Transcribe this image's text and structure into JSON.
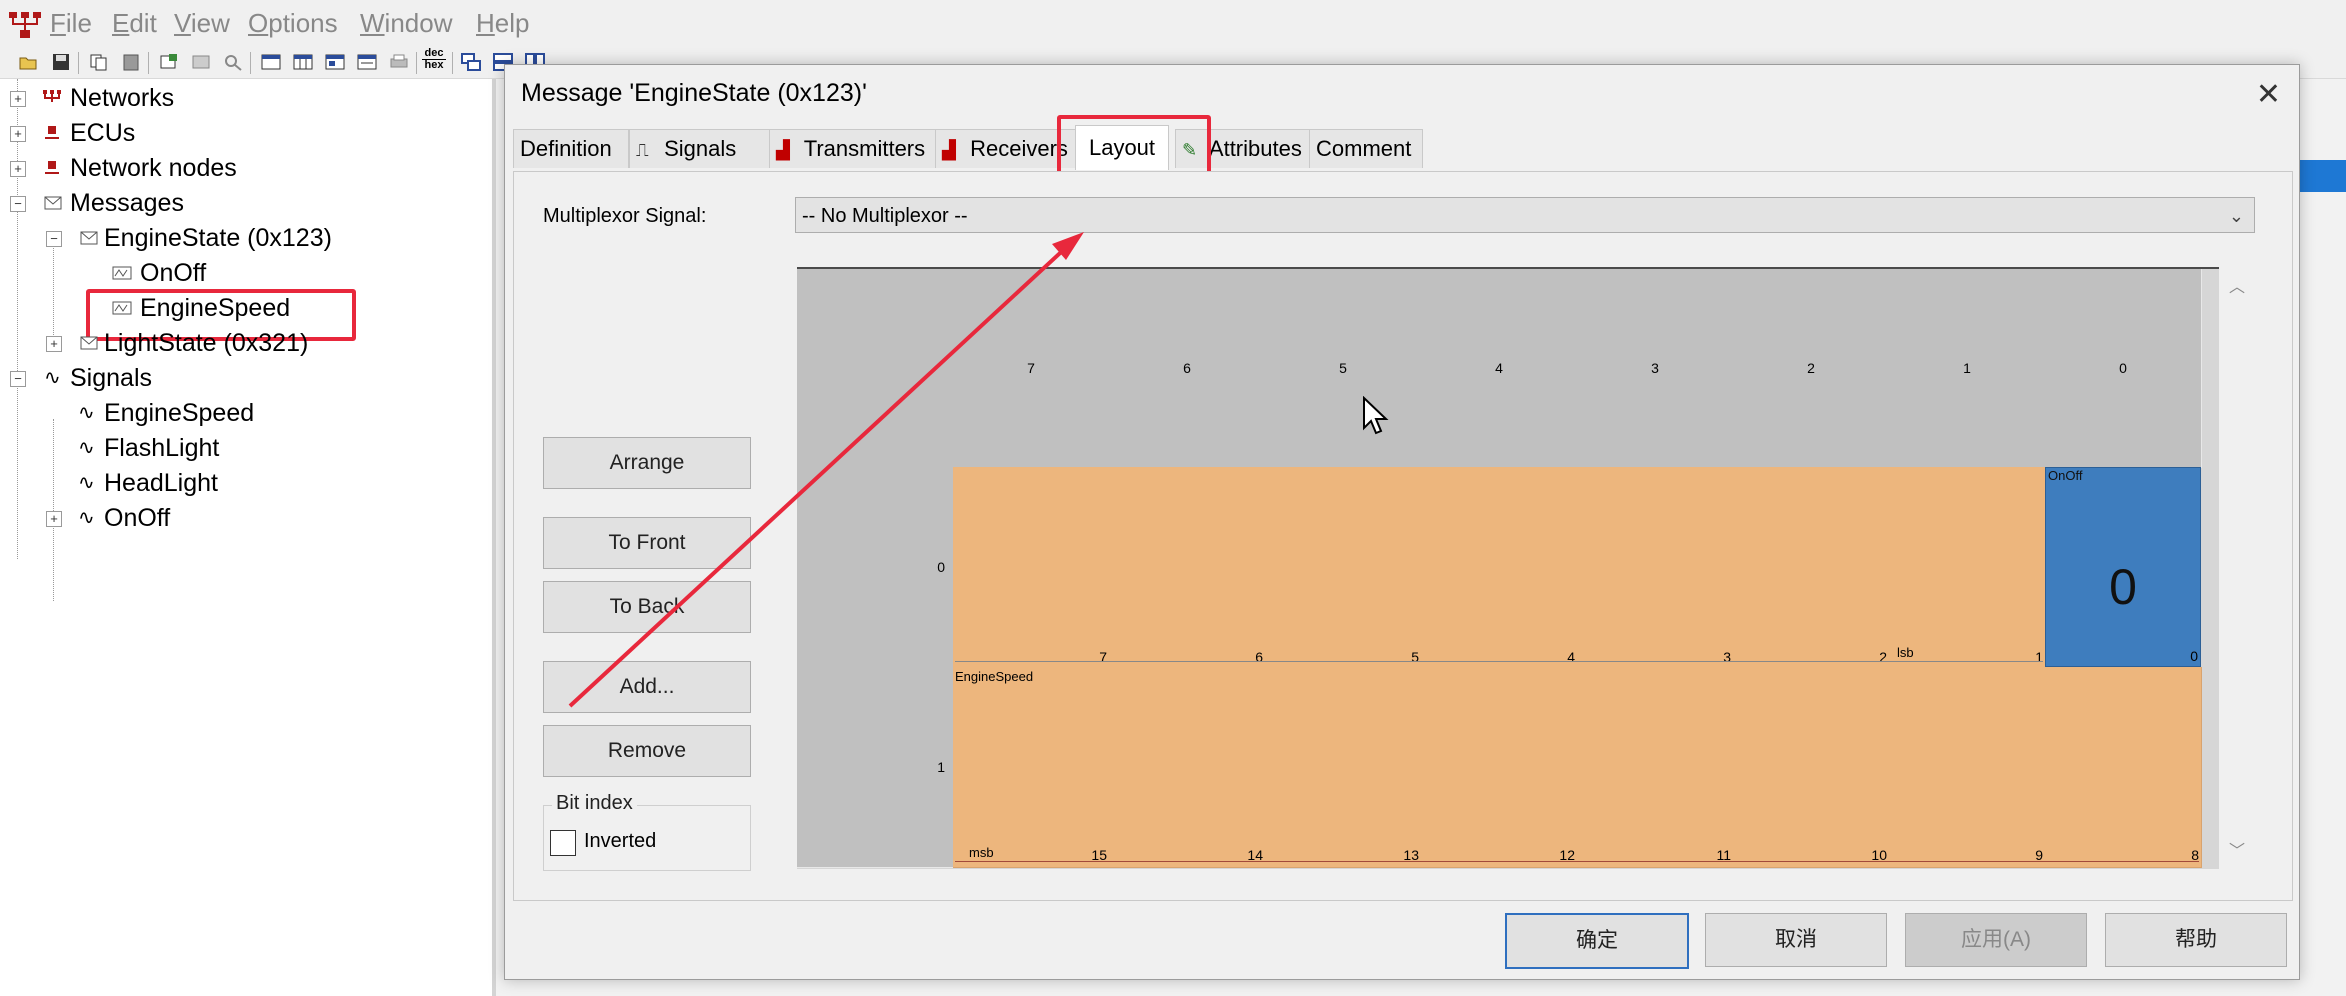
{
  "menubar": {
    "items": [
      "File",
      "Edit",
      "View",
      "Options",
      "Window",
      "Help"
    ],
    "underlines": [
      "F",
      "E",
      "V",
      "O",
      "W",
      "H"
    ],
    "rests": [
      "ile",
      "dit",
      "iew",
      "ptions",
      "indow",
      "elp"
    ]
  },
  "toolbar": {
    "icons": [
      "open-icon",
      "save-icon",
      "copy-icon",
      "paste-icon",
      "properties-icon",
      "grid-icon",
      "find-icon",
      "table-icon",
      "columns-icon",
      "window-icon",
      "window-alt-icon",
      "print-icon",
      "dec-hex-icon",
      "cascade-icon",
      "tile-horizontal-icon",
      "tile-vertical-icon"
    ],
    "dec_hex_label_top": "dec",
    "dec_hex_label_bottom": "hex"
  },
  "tree": {
    "networks": "Networks",
    "ecus": "ECUs",
    "network_nodes": "Network nodes",
    "messages": "Messages",
    "engine_state": "EngineState (0x123)",
    "onoff_child": "OnOff",
    "enginespeed_child": "EngineSpeed",
    "light_state": "LightState (0x321)",
    "signals": "Signals",
    "sig_enginespeed": "EngineSpeed",
    "sig_flashlight": "FlashLight",
    "sig_headlight": "HeadLight",
    "sig_onoff": "OnOff"
  },
  "dialog": {
    "title": "Message 'EngineState (0x123)'",
    "close": "✕",
    "tabs": {
      "definition": "Definition",
      "signals": "Signals",
      "transmitters": "Transmitters",
      "receivers": "Receivers",
      "layout": "Layout",
      "attributes": "Attributes",
      "comment": "Comment"
    },
    "multiplexor_label": "Multiplexor Signal:",
    "multiplexor_value": "-- No Multiplexor --",
    "buttons": {
      "arrange": "Arrange",
      "to_front": "To Front",
      "to_back": "To Back",
      "add": "Add...",
      "remove": "Remove"
    },
    "bit_index": {
      "title": "Bit index",
      "inverted": "Inverted",
      "checked": false
    },
    "footer": {
      "ok": "确定",
      "cancel": "取消",
      "apply": "应用(A)",
      "help": "帮助"
    }
  },
  "layout_grid": {
    "col_headers": [
      "7",
      "6",
      "5",
      "4",
      "3",
      "2",
      "1",
      "0"
    ],
    "row_headers": [
      "0",
      "1"
    ],
    "rows": [
      {
        "bits": [
          "7",
          "6",
          "5",
          "4",
          "3",
          "2",
          "1",
          "0"
        ]
      },
      {
        "bits": [
          "15",
          "14",
          "13",
          "12",
          "11",
          "10",
          "9",
          "8"
        ]
      }
    ],
    "signals": {
      "onoff_name": "OnOff",
      "onoff_value": "0",
      "enginespeed_name": "EngineSpeed",
      "lsb_label": "lsb",
      "msb_label": "msb"
    }
  },
  "colors": {
    "signal_fill": "#edb67d",
    "onoff_fill": "#3e7dbe",
    "highlight": "#e8283c",
    "accent_blue": "#1e78d4"
  }
}
